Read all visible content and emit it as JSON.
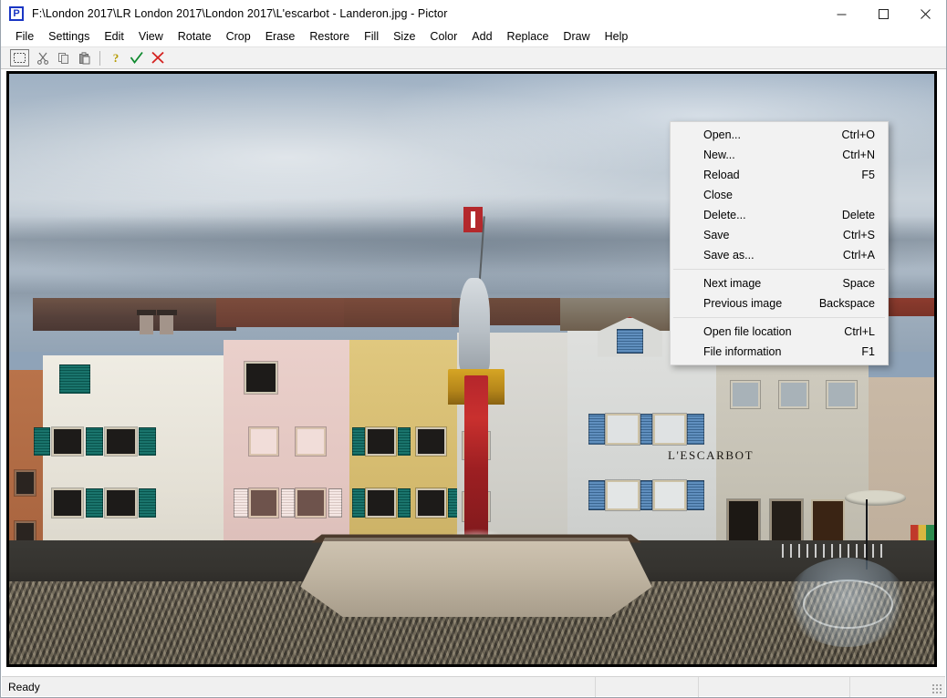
{
  "window": {
    "app_icon_letter": "P",
    "title": "F:\\London 2017\\LR London 2017\\London 2017\\L'escarbot - Landeron.jpg - Pictor",
    "minimize_label": "Minimize",
    "maximize_label": "Maximize",
    "close_label": "Close"
  },
  "menubar": {
    "items": [
      {
        "label": "File"
      },
      {
        "label": "Settings"
      },
      {
        "label": "Edit"
      },
      {
        "label": "View"
      },
      {
        "label": "Rotate"
      },
      {
        "label": "Crop"
      },
      {
        "label": "Erase"
      },
      {
        "label": "Restore"
      },
      {
        "label": "Fill"
      },
      {
        "label": "Size"
      },
      {
        "label": "Color"
      },
      {
        "label": "Add"
      },
      {
        "label": "Replace"
      },
      {
        "label": "Draw"
      },
      {
        "label": "Help"
      }
    ]
  },
  "toolbar": {
    "buttons": [
      {
        "name": "select-icon",
        "tooltip": "Select"
      },
      {
        "name": "cut-icon",
        "tooltip": "Cut"
      },
      {
        "name": "copy-icon",
        "tooltip": "Copy"
      },
      {
        "name": "paste-icon",
        "tooltip": "Paste"
      },
      {
        "name": "help-icon",
        "tooltip": "Help"
      },
      {
        "name": "confirm-check-icon",
        "tooltip": "Apply"
      },
      {
        "name": "cancel-x-icon",
        "tooltip": "Cancel"
      }
    ]
  },
  "file_menu": {
    "groups": [
      [
        {
          "label": "Open...",
          "accel": "Ctrl+O"
        },
        {
          "label": "New...",
          "accel": "Ctrl+N"
        },
        {
          "label": "Reload",
          "accel": "F5"
        },
        {
          "label": "Close",
          "accel": ""
        },
        {
          "label": "Delete...",
          "accel": "Delete"
        },
        {
          "label": "Save",
          "accel": "Ctrl+S"
        },
        {
          "label": "Save as...",
          "accel": "Ctrl+A"
        }
      ],
      [
        {
          "label": "Next image",
          "accel": "Space"
        },
        {
          "label": "Previous image",
          "accel": "Backspace"
        }
      ],
      [
        {
          "label": "Open file location",
          "accel": "Ctrl+L"
        },
        {
          "label": "File information",
          "accel": "F1"
        }
      ]
    ]
  },
  "photo": {
    "description": "Village square with colourful old houses, an octagonal stone fountain with a painted knight statue holding a red-and-white flag, and a shop front",
    "shop_sign": "L'ESCARBOT",
    "colors": {
      "sky": "#b3c0cc",
      "roof": "#6b3f33",
      "house_white": "#e8e4dc",
      "house_pink": "#e6ccc8",
      "house_yellow": "#d9c27a",
      "shutter_teal": "#0c6b63",
      "shutter_blue": "#4a7fb5",
      "fountain_red": "#b5262c",
      "fountain_gold": "#d6a524",
      "cobbles": "#57513f"
    }
  },
  "statusbar": {
    "panels": [
      {
        "text": "Ready"
      },
      {
        "text": ""
      },
      {
        "text": ""
      },
      {
        "text": ""
      }
    ]
  }
}
